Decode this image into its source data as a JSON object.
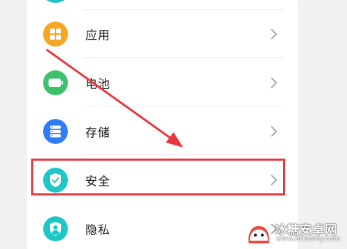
{
  "settings": {
    "items": [
      {
        "label": "应用",
        "icon": "apps-icon",
        "color": "#f5a623"
      },
      {
        "label": "电池",
        "icon": "battery-icon",
        "color": "#3dc26b"
      },
      {
        "label": "存储",
        "icon": "storage-icon",
        "color": "#2f7cf6"
      },
      {
        "label": "安全",
        "icon": "security-shield-icon",
        "color": "#1ec6c6"
      },
      {
        "label": "隐私",
        "icon": "privacy-icon",
        "color": "#1ec6c6"
      }
    ]
  },
  "annotation": {
    "highlight_color": "#e8373c",
    "arrow_color": "#e8373c",
    "highlighted_item": "安全"
  },
  "watermark": {
    "title": "冰糖安卓网",
    "url": "www.btxtdmy.com"
  }
}
